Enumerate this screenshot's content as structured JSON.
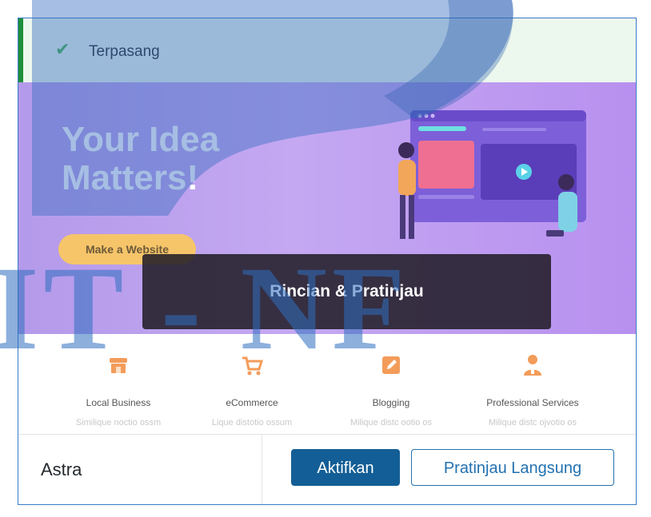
{
  "notice": {
    "icon": "check-icon",
    "text": "Terpasang"
  },
  "screenshot": {
    "headline_line1": "Your Idea",
    "headline_line2": "Matters!",
    "cta": "Make a Website",
    "features": [
      {
        "icon": "store-icon",
        "title": "Local Business",
        "desc": "Similique noctio ossm"
      },
      {
        "icon": "cart-icon",
        "title": "eCommerce",
        "desc": "Lique distotio ossum"
      },
      {
        "icon": "edit-icon",
        "title": "Blogging",
        "desc": "Milique distc ootio os"
      },
      {
        "icon": "person-icon",
        "title": "Professional Services",
        "desc": "Milique distc ojvotio os"
      }
    ]
  },
  "overlay_label": "Rincian & Pratinjau",
  "footer": {
    "theme_name": "Astra",
    "activate_label": "Aktifkan",
    "live_preview_label": "Pratinjau Langsung"
  },
  "watermark": {
    "text": "IT - NF"
  },
  "colors": {
    "primary": "#135e96",
    "accent": "#2271b1",
    "notice_border": "#1e8f3c",
    "feature_icon": "#f39c5a"
  }
}
